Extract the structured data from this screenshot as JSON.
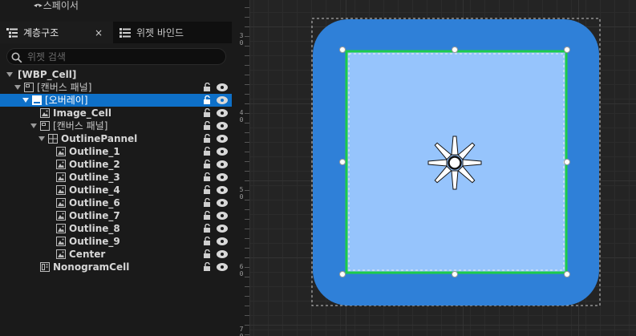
{
  "palette": {
    "spacer_label": "스페이서",
    "spacer_icon": "spacer-icon"
  },
  "tabs": {
    "hierarchy": {
      "label": "계층구조",
      "icon": "hierarchy-icon",
      "close": "×"
    },
    "bindings": {
      "label": "위젯 바인드",
      "icon": "bind-icon"
    }
  },
  "search": {
    "placeholder": "위젯 검색",
    "value": ""
  },
  "tree": [
    {
      "label": "[WBP_Cell]",
      "depth": 0,
      "expander": true,
      "icon": null,
      "bold": true,
      "selected": false,
      "controls": false
    },
    {
      "label": "[캔버스 패널]",
      "depth": 1,
      "expander": true,
      "icon": "canvas-panel-icon",
      "bold": false,
      "selected": false,
      "controls": true
    },
    {
      "label": "[오버레이]",
      "depth": 2,
      "expander": true,
      "icon": "overlay-icon",
      "bold": false,
      "selected": true,
      "controls": true
    },
    {
      "label": "Image_Cell",
      "depth": 3,
      "expander": false,
      "icon": "image-icon",
      "bold": true,
      "selected": false,
      "controls": true
    },
    {
      "label": "[캔버스 패널]",
      "depth": 3,
      "expander": true,
      "icon": "canvas-panel-icon",
      "bold": false,
      "selected": false,
      "controls": true
    },
    {
      "label": "OutlinePannel",
      "depth": 4,
      "expander": true,
      "icon": "grid-panel-icon",
      "bold": true,
      "selected": false,
      "controls": true
    },
    {
      "label": "Outline_1",
      "depth": 5,
      "expander": false,
      "icon": "image-icon",
      "bold": true,
      "selected": false,
      "controls": true
    },
    {
      "label": "Outline_2",
      "depth": 5,
      "expander": false,
      "icon": "image-icon",
      "bold": true,
      "selected": false,
      "controls": true
    },
    {
      "label": "Outline_3",
      "depth": 5,
      "expander": false,
      "icon": "image-icon",
      "bold": true,
      "selected": false,
      "controls": true
    },
    {
      "label": "Outline_4",
      "depth": 5,
      "expander": false,
      "icon": "image-icon",
      "bold": true,
      "selected": false,
      "controls": true
    },
    {
      "label": "Outline_6",
      "depth": 5,
      "expander": false,
      "icon": "image-icon",
      "bold": true,
      "selected": false,
      "controls": true
    },
    {
      "label": "Outline_7",
      "depth": 5,
      "expander": false,
      "icon": "image-icon",
      "bold": true,
      "selected": false,
      "controls": true
    },
    {
      "label": "Outline_8",
      "depth": 5,
      "expander": false,
      "icon": "image-icon",
      "bold": true,
      "selected": false,
      "controls": true
    },
    {
      "label": "Outline_9",
      "depth": 5,
      "expander": false,
      "icon": "image-icon",
      "bold": true,
      "selected": false,
      "controls": true
    },
    {
      "label": "Center",
      "depth": 5,
      "expander": false,
      "icon": "image-icon",
      "bold": true,
      "selected": false,
      "controls": true
    },
    {
      "label": "NonogramCell",
      "depth": 3,
      "expander": false,
      "icon": "user-widget-icon",
      "bold": true,
      "selected": false,
      "controls": true
    }
  ],
  "ruler": {
    "labels": [
      "3\n0",
      "4\n0",
      "5\n0",
      "6\n0",
      "7\n0"
    ]
  },
  "canvas": {
    "cell_color": "#2f80d8",
    "inner_color": "#96c4fc",
    "selection_color": "#1dcc4a",
    "anchor_icon": "anchor-icon"
  },
  "colors": {
    "selected_row": "#0e70c8"
  }
}
